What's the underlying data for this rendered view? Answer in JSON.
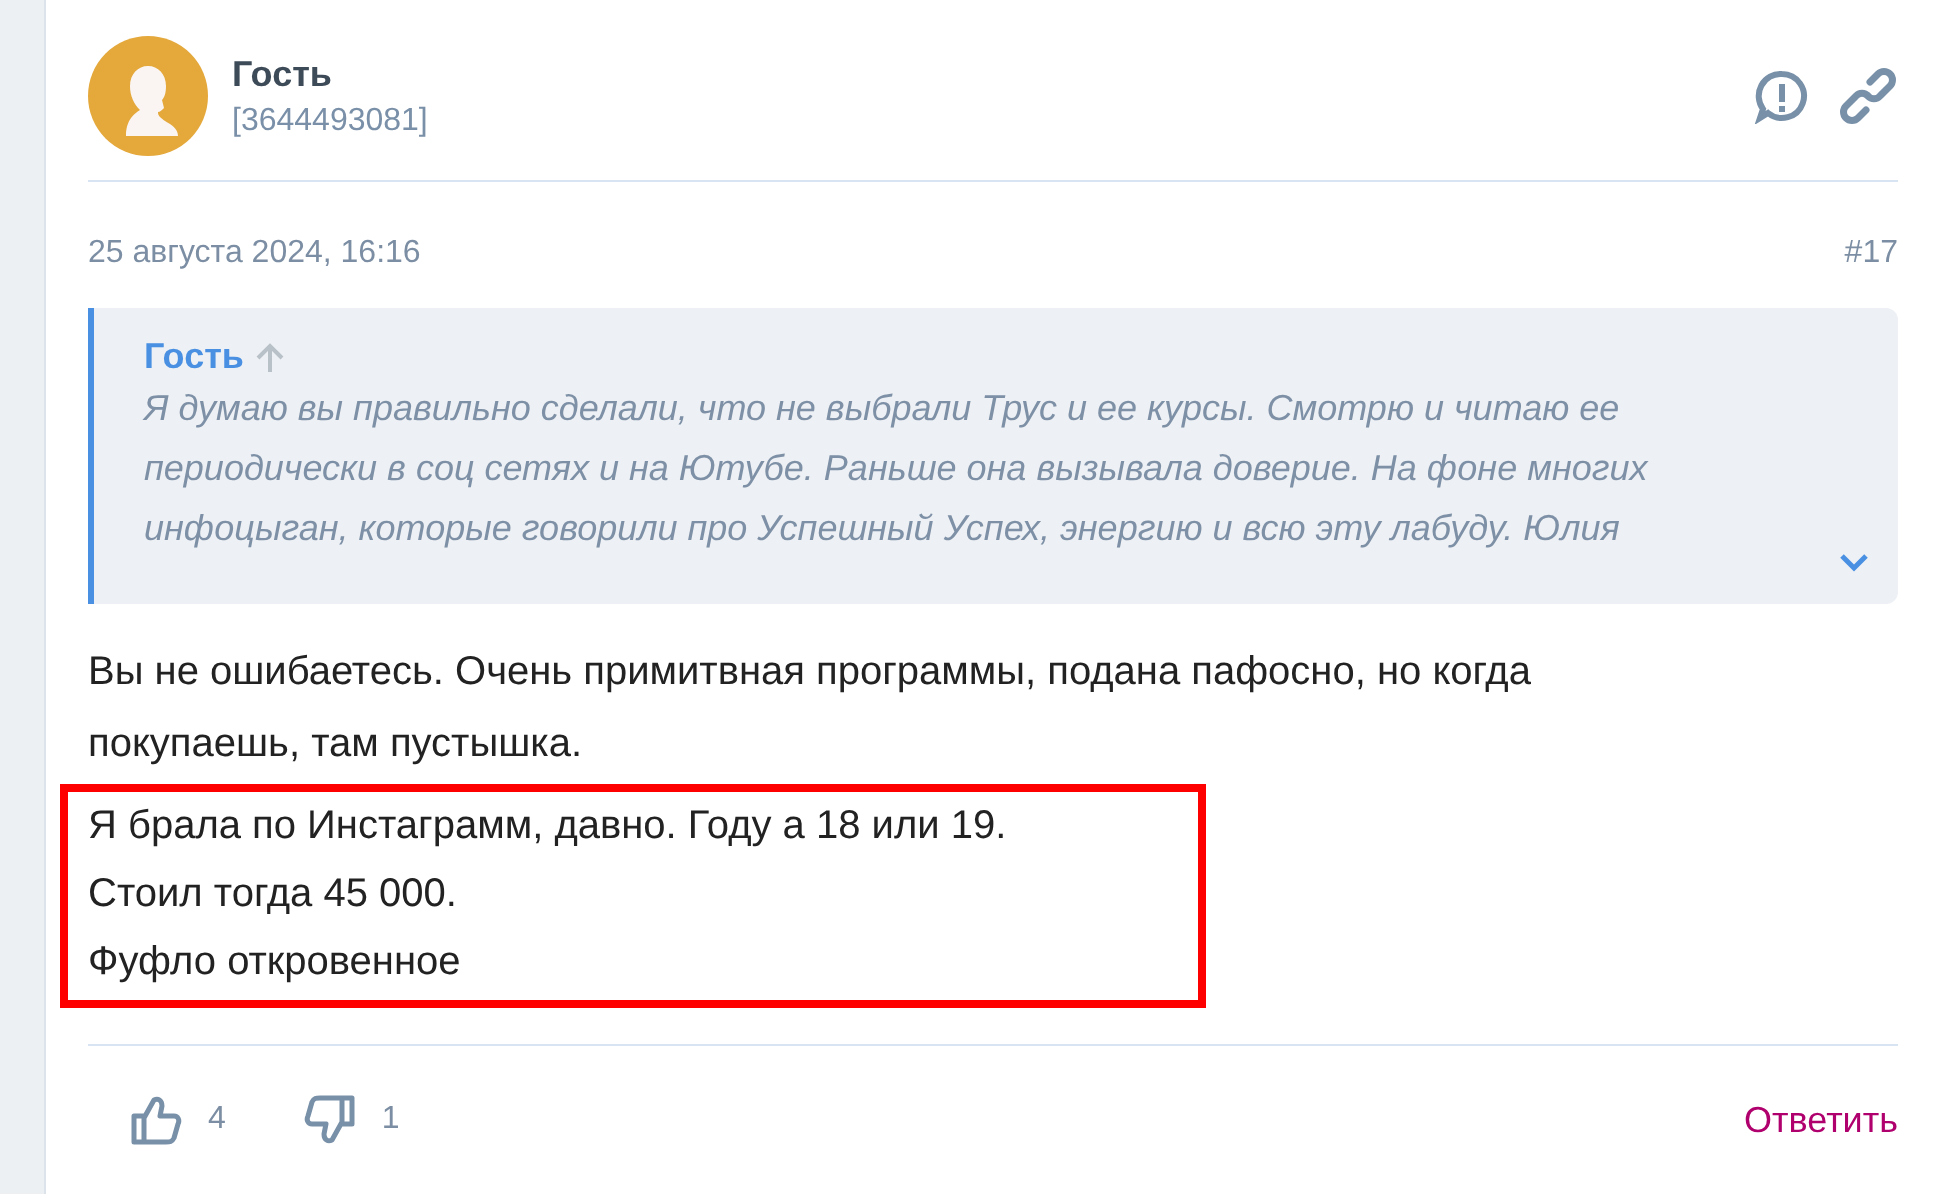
{
  "post": {
    "author": "Гость",
    "user_id": "[3644493081]",
    "date": "25 августа 2024, 16:16",
    "number": "#17",
    "quote": {
      "author": "Гость",
      "lines": [
        "Я думаю вы правильно сделали, что не выбрали Трус и ее курсы. Смотрю и читаю ее",
        "периодически в соц сетях и на Ютубе. Раньше она вызывала доверие. На фоне многих",
        "инфоцыган, которые говорили про Успешный Успех, энергию и всю эту лабуду. Юлия"
      ]
    },
    "body": [
      {
        "text": "Вы не ошибаетесь. Очень примитвная программы, подана пафосно, но когда",
        "highlighted": false
      },
      {
        "text": "покупаешь, там пустышка.",
        "highlighted": false
      },
      {
        "text": "Я брала по Инстаграмм, давно. Году а 18 или 19.",
        "highlighted": true
      },
      {
        "text": "Стоил тогда 45 000.",
        "highlighted": true
      },
      {
        "text": "Фуфло откровенное",
        "highlighted": true
      }
    ],
    "likes": "4",
    "dislikes": "1",
    "reply": "Ответить"
  }
}
